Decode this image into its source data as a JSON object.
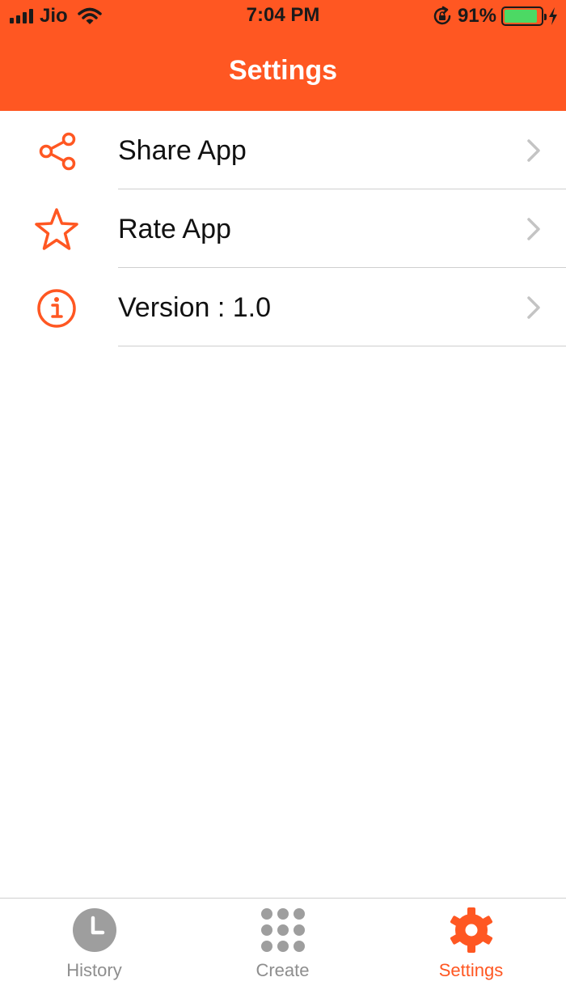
{
  "status_bar": {
    "carrier": "Jio",
    "time": "7:04 PM",
    "battery_percent": "91%",
    "battery_level": 0.91,
    "icons": [
      "signal-icon",
      "wifi-icon",
      "rotation-lock-icon",
      "battery-icon",
      "charging-icon"
    ]
  },
  "header": {
    "title": "Settings",
    "background_color": "#FF5722"
  },
  "settings": {
    "items": [
      {
        "label": "Share App",
        "icon": "share-icon"
      },
      {
        "label": "Rate App",
        "icon": "star-icon"
      },
      {
        "label": "Version : 1.0",
        "icon": "info-icon"
      }
    ]
  },
  "tab_bar": {
    "tabs": [
      {
        "label": "History",
        "icon": "clock-icon",
        "selected": false
      },
      {
        "label": "Create",
        "icon": "grid-icon",
        "selected": false
      },
      {
        "label": "Settings",
        "icon": "gear-icon",
        "selected": true
      }
    ],
    "active_color": "#FF5722",
    "inactive_color": "#8e8e8e"
  }
}
